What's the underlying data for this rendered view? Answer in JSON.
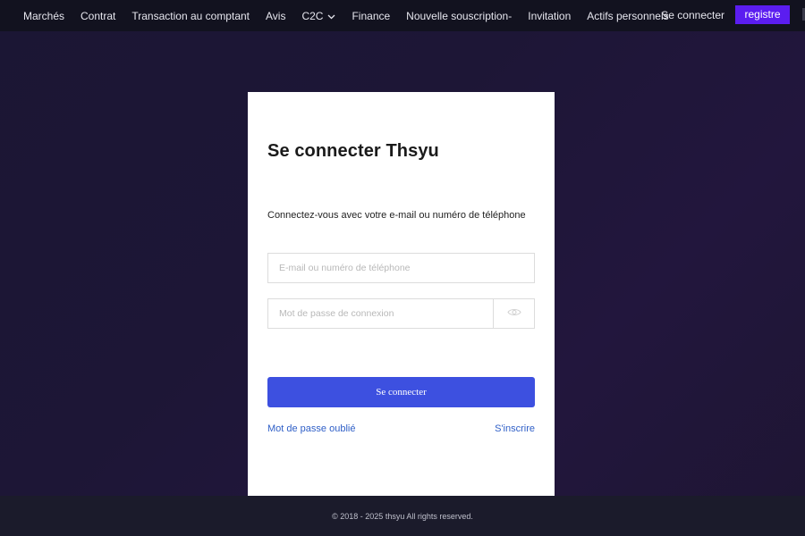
{
  "nav": {
    "items": [
      {
        "label": "Marchés"
      },
      {
        "label": "Contrat"
      },
      {
        "label": "Transaction au comptant"
      },
      {
        "label": "Avis"
      },
      {
        "label": "C2C",
        "dropdown": true
      },
      {
        "label": "Finance"
      },
      {
        "label": "Nouvelle souscription-"
      },
      {
        "label": "Invitation"
      },
      {
        "label": "Actifs personnels"
      }
    ],
    "login_label": "Se connecter",
    "register_label": "registre"
  },
  "login": {
    "title": "Se connecter Thsyu",
    "subtitle": "Connectez-vous avec votre e-mail ou numéro de téléphone",
    "email_placeholder": "E-mail ou numéro de téléphone",
    "email_value": "",
    "password_placeholder": "Mot de passe de connexion",
    "password_value": "",
    "submit_label": "Se connecter",
    "forgot_label": "Mot de passe oublié",
    "signup_label": "S'inscrire"
  },
  "footer": {
    "text": "© 2018 - 2025 thsyu All rights reserved."
  },
  "colors": {
    "primary_button": "#3d50e0",
    "register_button": "#5b1df0",
    "link": "#2f5fc7"
  },
  "icons": {
    "chevron": "chevron-down-icon",
    "password_toggle": "eye-icon"
  }
}
